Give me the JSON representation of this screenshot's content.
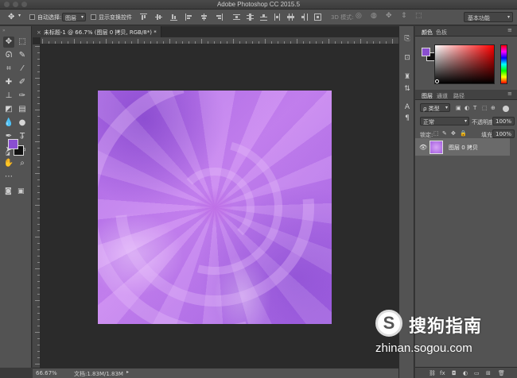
{
  "window": {
    "title": "Adobe Photoshop CC 2015.5"
  },
  "options_bar": {
    "auto_select_label": "自动选择:",
    "auto_select_value": "图层",
    "show_transform_label": "显示变换控件",
    "mode_3d_label": "3D 模式:",
    "workspace_value": "基本功能"
  },
  "document": {
    "tab_title": "未标题-1 @ 66.7% (图层 0 拷贝, RGB/8*) *",
    "close_glyph": "×"
  },
  "status_bar": {
    "zoom": "66.67%",
    "doc_info": "文档:1.83M/1.83M"
  },
  "color_panel": {
    "tabs": [
      "颜色",
      "色板"
    ],
    "foreground_color": "#8a4fd0"
  },
  "layers_panel": {
    "tabs": [
      "图层",
      "通道",
      "路径"
    ],
    "filter_value": "ρ 类型",
    "blend_mode": "正常",
    "opacity_label": "不透明度:",
    "opacity_value": "100%",
    "lock_label": "锁定:",
    "fill_label": "填充:",
    "fill_value": "100%",
    "layers": [
      {
        "name": "图层 0 拷贝",
        "visible": true
      }
    ],
    "footer_icons": [
      "link-icon",
      "fx",
      "mask-icon",
      "adjustment-icon",
      "folder-icon",
      "new-layer-icon",
      "trash-icon"
    ],
    "fx_label": "fx"
  },
  "watermark": {
    "logo_glyph": "S",
    "text_cn": "搜狗指南",
    "url": "zhinan.sogou.com"
  }
}
